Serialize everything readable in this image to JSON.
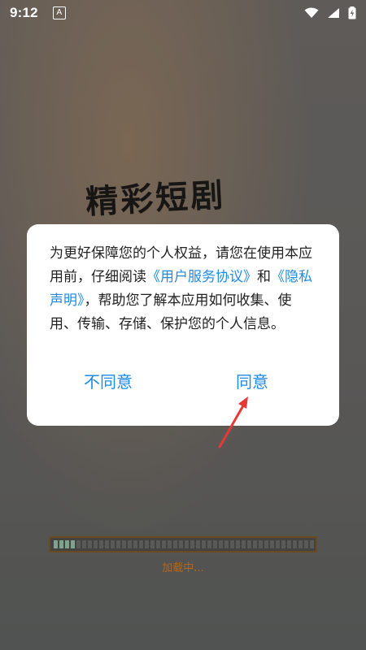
{
  "status_bar": {
    "time": "9:12",
    "badge": "A",
    "icons": [
      "wifi-icon",
      "signal-icon",
      "battery-charging-icon"
    ]
  },
  "app": {
    "title": "精彩短剧"
  },
  "dialog": {
    "text_part1": "为更好保障您的个人权益，请您在使用本应用前，仔细阅读",
    "link1": "《用户服务协议》",
    "text_part2": "和",
    "link2": "《隐私声明》",
    "text_part3": "，帮助您了解本应用如何收集、使用、传输、存储、保护您的个人信息。",
    "disagree_label": "不同意",
    "agree_label": "同意"
  },
  "loading": {
    "progress": 0.09,
    "label": "加载中..."
  },
  "colors": {
    "link": "#1d8ae6",
    "annotation_arrow": "#e53935",
    "loading_text": "#b5661e",
    "progress_fill": "#7fa38f"
  }
}
